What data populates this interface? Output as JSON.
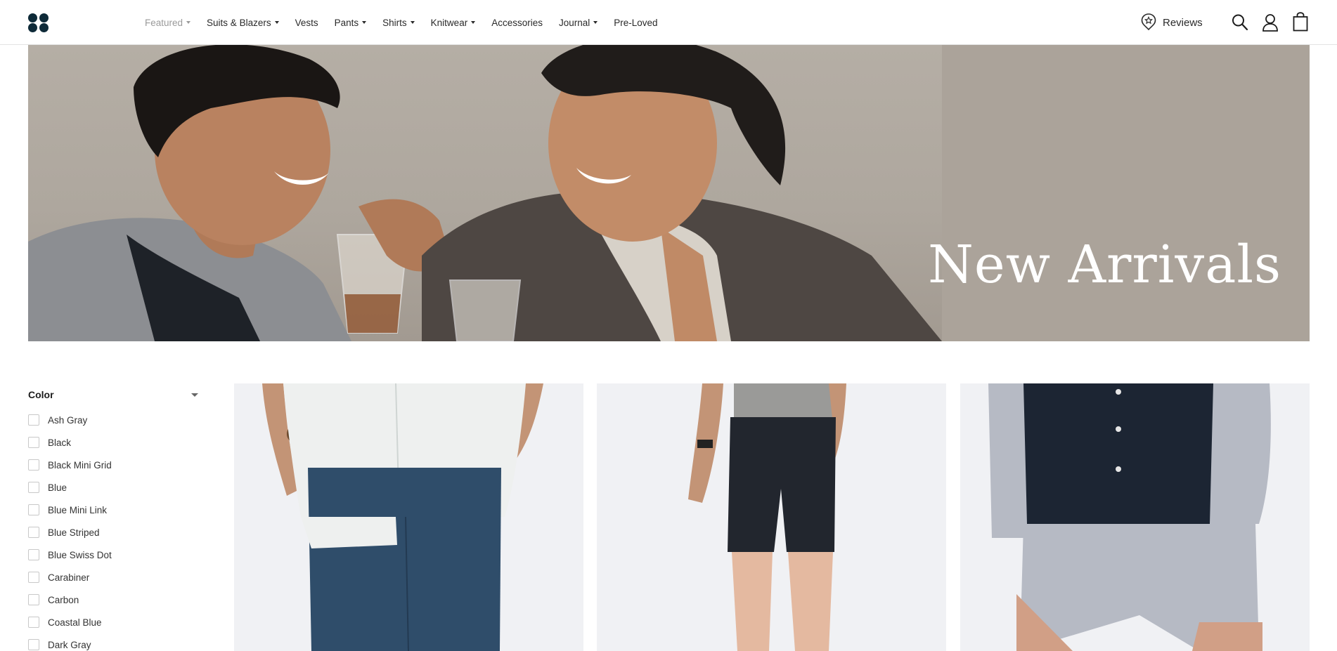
{
  "header": {
    "nav": [
      {
        "label": "Featured",
        "has_dropdown": true,
        "active": true
      },
      {
        "label": "Suits & Blazers",
        "has_dropdown": true
      },
      {
        "label": "Vests",
        "has_dropdown": false
      },
      {
        "label": "Pants",
        "has_dropdown": true
      },
      {
        "label": "Shirts",
        "has_dropdown": true
      },
      {
        "label": "Knitwear",
        "has_dropdown": true
      },
      {
        "label": "Accessories",
        "has_dropdown": false
      },
      {
        "label": "Journal",
        "has_dropdown": true
      },
      {
        "label": "Pre-Loved",
        "has_dropdown": false
      }
    ],
    "reviews_label": "Reviews",
    "icons": [
      "logo-dots-icon",
      "reviews-badge-icon",
      "search-icon",
      "account-icon",
      "cart-bag-icon"
    ]
  },
  "hero": {
    "title": "New Arrivals"
  },
  "filters": {
    "color": {
      "title": "Color",
      "options": [
        "Ash Gray",
        "Black",
        "Black Mini Grid",
        "Blue",
        "Blue Mini Link",
        "Blue Striped",
        "Blue Swiss Dot",
        "Carabiner",
        "Carbon",
        "Coastal Blue",
        "Dark Gray"
      ]
    }
  },
  "products": [
    {
      "shirt_color": "#eef0ef",
      "shorts_color": "#2f4d6a"
    },
    {
      "shirt_color": "#9a9a98",
      "shorts_color": "#22262e"
    },
    {
      "shirt_color": "#1c2533",
      "shorts_color": "#b6bac4"
    }
  ],
  "colors": {
    "brand": "#0e2a38",
    "text": "#2a2a2a",
    "muted_nav": "#9a9a9a",
    "hero_bg": "#aea79e",
    "card_bg": "#f0f0f3"
  }
}
